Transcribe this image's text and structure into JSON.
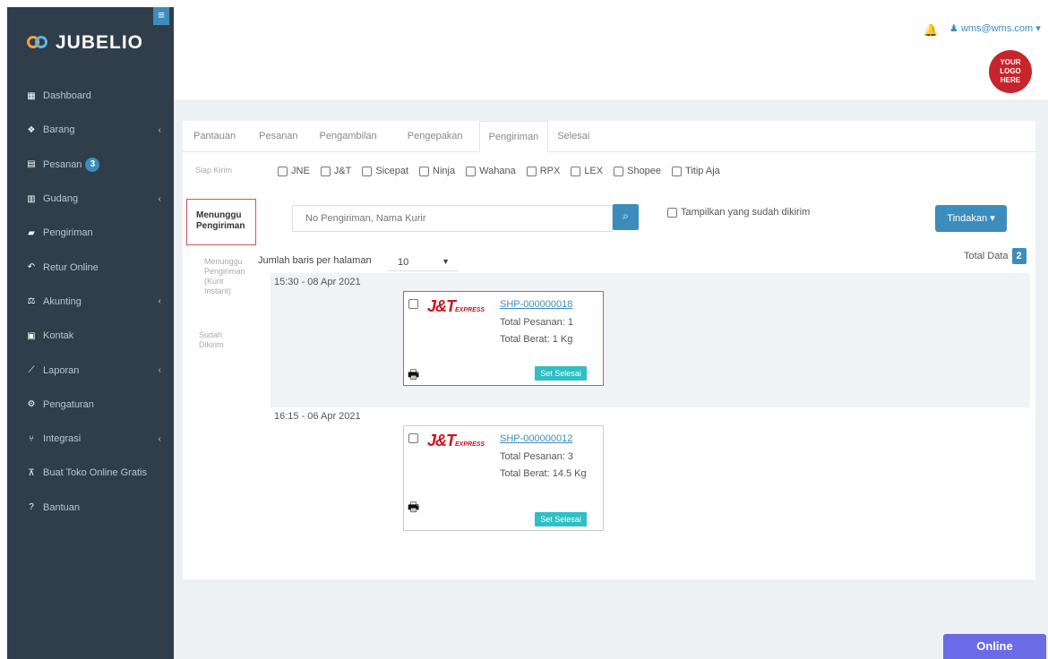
{
  "brand": {
    "name": "JUBELIO",
    "menu_icon": "hamburger-icon"
  },
  "sidebar": {
    "items": [
      {
        "label": "Dashboard",
        "icon": "chart-icon",
        "chev": ""
      },
      {
        "label": "Barang",
        "icon": "cubes-icon",
        "chev": "‹"
      },
      {
        "label": "Pesanan",
        "icon": "basket-icon",
        "chev": "",
        "badge": "3"
      },
      {
        "label": "Gudang",
        "icon": "warehouse-icon",
        "chev": "‹"
      },
      {
        "label": "Pengiriman",
        "icon": "truck-icon",
        "chev": ""
      },
      {
        "label": "Retur Online",
        "icon": "reply-icon",
        "chev": ""
      },
      {
        "label": "Akunting",
        "icon": "balance-icon",
        "chev": "‹"
      },
      {
        "label": "Kontak",
        "icon": "contact-icon",
        "chev": ""
      },
      {
        "label": "Laporan",
        "icon": "line-chart-icon",
        "chev": "‹"
      },
      {
        "label": "Pengaturan",
        "icon": "cogs-icon",
        "chev": ""
      },
      {
        "label": "Integrasi",
        "icon": "sitemap-icon",
        "chev": "‹"
      },
      {
        "label": "Buat Toko Online Gratis",
        "icon": "cart-icon",
        "chev": ""
      },
      {
        "label": "Bantuan",
        "icon": "question-icon",
        "chev": ""
      }
    ]
  },
  "header": {
    "user": "wms@wms.com",
    "logo_text": [
      "YOUR",
      "LOGO",
      "HERE"
    ]
  },
  "tabs": [
    "Pantauan",
    "Pesanan",
    "Pengambilan",
    "Pengepakan",
    "Pengiriman",
    "Selesai"
  ],
  "active_tab": "Pengiriman",
  "subnav": {
    "siap_kirim": "Siap Kirim",
    "menunggu": "Menunggu Pengiriman",
    "menunggu_instant": "Menunggu Pengiriman (Kurir Instant)",
    "sudah": "Sudah Dikirim"
  },
  "couriers": [
    "JNE",
    "J&T",
    "Sicepat",
    "Ninja",
    "Wahana",
    "RPX",
    "LEX",
    "Shopee",
    "Titip Aja"
  ],
  "search": {
    "placeholder": "No Pengiriman, Nama Kurir"
  },
  "show_sent_label": "Tampilkan yang sudah dikirim",
  "tindakan_label": "Tindakan",
  "rows": {
    "label": "Jumlah baris per halaman",
    "value": "10"
  },
  "total": {
    "label": "Total Data",
    "value": "2"
  },
  "groups": [
    {
      "time": "15:30 - 08 Apr 2021",
      "shp": "SHP-000000018",
      "pesanan": "Total Pesanan: 1",
      "berat": "Total Berat: 1 Kg",
      "set": "Set Selesai"
    },
    {
      "time": "16:15 - 06 Apr 2021",
      "shp": "SHP-000000012",
      "pesanan": "Total Pesanan: 3",
      "berat": "Total Berat: 14.5 Kg",
      "set": "Set Selesai"
    }
  ],
  "jt": {
    "main": "J&T",
    "sub": "EXPRESS"
  },
  "online_label": "Online"
}
